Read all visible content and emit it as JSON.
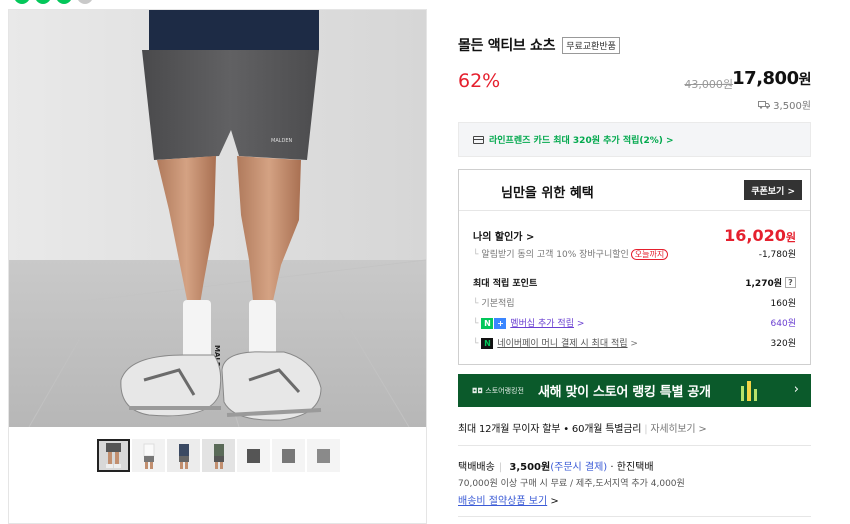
{
  "product": {
    "title": "몰든 액티브 쇼츠",
    "badge": "무료교환반품",
    "discount_rate": "62%",
    "original_price": "43,000원",
    "sale_price": "17,800",
    "sale_won": "원",
    "shipping_fee": "3,500원",
    "thumbnails": 7,
    "image_logo": "MALDEN"
  },
  "card_banner": {
    "text": "라인프렌즈 카드 최대 320원 추가 적립(2%) >"
  },
  "benefits": {
    "title": "님만을 위한 혜택",
    "coupon_button": "쿠폰보기 >",
    "my_discount_label": "나의 할인가 >",
    "my_discount_value": "16,020",
    "my_discount_won": "원",
    "alarm_text": "알림받기 동의 고객 10% 장바구니할인",
    "alarm_pill": "오늘까지",
    "alarm_value": "-1,780원",
    "points_label": "최대 적립 포인트",
    "points_value": "1,270원",
    "points_help": "?",
    "basic_label": "기본적립",
    "basic_value": "160원",
    "membership_label": "멤버십 추가 적립",
    "membership_value": "640원",
    "naverpay_label": "네이버페이 머니 결제 시 최대 적립",
    "naverpay_value": "320원"
  },
  "store_banner": {
    "tag": "◘◘ 스토어랭킹전",
    "text": "새해 맞이 스토어 랭킹 특별 공개",
    "arrow": "›"
  },
  "installment": {
    "main": "최대 12개월 무이자 할부 • 60개월 특별금리",
    "link": "자세히보기 >"
  },
  "shipping": {
    "label": "택배배송",
    "fee": "3,500원",
    "fee_note": "(주문시 결제)",
    "carrier": "· 한진택배",
    "detail": "70,000원 이상 구매 시 무료 / 제주,도서지역 추가 4,000원",
    "save_link": "배송비 절약상품 보기",
    "save_arrow": ">"
  },
  "colors": {
    "accent_red": "#e5202e",
    "naver_green": "#03c75a",
    "banner_green": "#0b5a2b"
  }
}
